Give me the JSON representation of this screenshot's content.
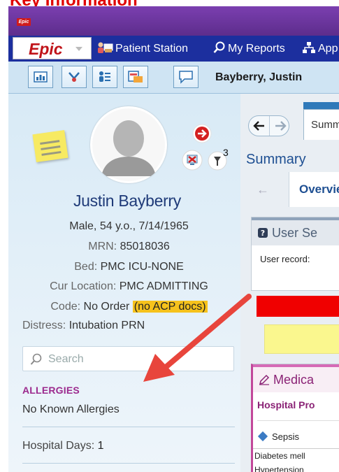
{
  "page_heading": "Key Information",
  "titlebar": {
    "logo_text": "Epic"
  },
  "menubar": {
    "epic_button_label": "Epic",
    "items": [
      {
        "label": "Patient Station"
      },
      {
        "label": "My Reports"
      },
      {
        "label": "App"
      }
    ]
  },
  "toolbar": {
    "buttons": [
      "dashboard-icon",
      "chart-review-icon",
      "patient-list-icon",
      "schedule-icon",
      "chat-icon"
    ],
    "patient_name": "Bayberry, Justin"
  },
  "storyboard": {
    "patient_name": "Justin Bayberry",
    "demographics": "Male, 54 y.o., 7/14/1965",
    "mrn_label": "MRN:",
    "mrn_value": "85018036",
    "bed_label": "Bed:",
    "bed_value": "PMC ICU-NONE",
    "location_label": "Cur Location:",
    "location_value": "PMC ADMITTING",
    "code_label": "Code:",
    "code_value": "No Order",
    "code_flag": "(no ACP docs)",
    "distress_label": "Distress:",
    "distress_value": "Intubation PRN",
    "search_placeholder": "Search",
    "allergies_header": "ALLERGIES",
    "allergies_value": "No Known Allergies",
    "hospital_days_label": "Hospital Days:",
    "hospital_days_value": "1",
    "flag_count": "3"
  },
  "main": {
    "tab_label": "Summ",
    "section_title": "Summary",
    "subtab_label": "Overvie",
    "user_card_title": "User Se",
    "user_card_field": "User record:",
    "med_card_title": "Medica",
    "med_card_sub": "Hospital Pro",
    "problems": [
      "Sepsis",
      "Diabetes mell",
      "Hypertension"
    ]
  },
  "colors": {
    "accent_red": "#f00000",
    "arrow_red": "#e8453c",
    "code_highlight": "#f6c21c",
    "allergy_header": "#9c2a8e"
  }
}
